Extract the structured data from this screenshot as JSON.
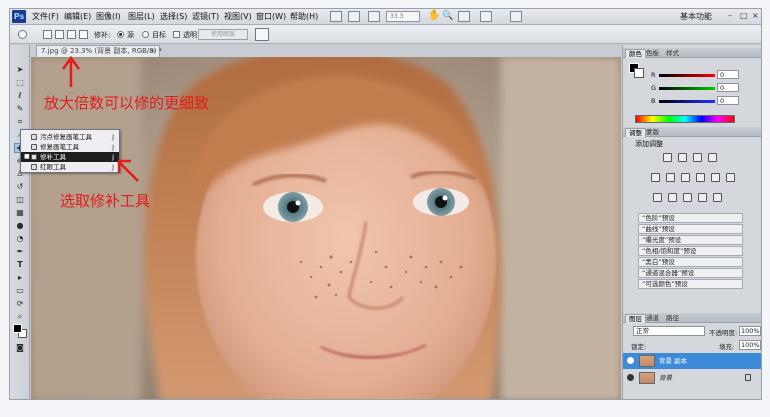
{
  "app": {
    "logo": "Ps",
    "menu": [
      "文件(F)",
      "编辑(E)",
      "图像(I)",
      "图层(L)",
      "选择(S)",
      "滤镜(T)",
      "视图(V)",
      "窗口(W)",
      "帮助(H)"
    ],
    "zoom_field": "33.3",
    "workspace": "基本功能",
    "window_buttons": [
      "–",
      "□",
      "×"
    ]
  },
  "options": {
    "patch_label": "修补:",
    "source_label": "源",
    "dest_label": "目标",
    "transparent_label": "透明",
    "use_pattern": "使用图案"
  },
  "document": {
    "tab_title": "7.jpg @ 23.3% (背景 副本, RGB/8) *",
    "close": "×"
  },
  "flyout": {
    "items": [
      {
        "label": "污点修复画笔工具",
        "key": "J",
        "selected": false
      },
      {
        "label": "修复画笔工具",
        "key": "J",
        "selected": false
      },
      {
        "label": "修补工具",
        "key": "J",
        "selected": true
      },
      {
        "label": "红眼工具",
        "key": "J",
        "selected": false
      }
    ]
  },
  "annotations": {
    "zoom_note": "放大倍数可以修的更细致",
    "tool_note": "选取修补工具"
  },
  "panels": {
    "color_tabs": [
      "颜色",
      "色板",
      "样式"
    ],
    "rgb": [
      {
        "channel": "R",
        "value": "0",
        "color": "#e02020"
      },
      {
        "channel": "G",
        "value": "0",
        "color": "#20b020"
      },
      {
        "channel": "B",
        "value": "0",
        "color": "#2040e0"
      }
    ],
    "adjust_tabs": [
      "调整",
      "蒙版"
    ],
    "adjust_title": "添加调整",
    "presets": [
      "“色阶”预设",
      "“曲线”预设",
      "“曝光度”预设",
      "“色相/饱和度”预设",
      "“黑白”预设",
      "“通道混合器”预设",
      "“可选颜色”预设"
    ],
    "layer_tabs": [
      "图层",
      "通道",
      "路径"
    ],
    "blend_mode": "正常",
    "opacity_label": "不透明度:",
    "opacity": "100%",
    "lock_label": "锁定:",
    "fill_label": "填充:",
    "fill": "100%",
    "layers": [
      {
        "name": "背景 副本",
        "selected": true
      },
      {
        "name": "背景",
        "selected": false
      }
    ]
  },
  "colors": {
    "annotation": "#e31b1b",
    "selection": "#3d8ad8"
  }
}
